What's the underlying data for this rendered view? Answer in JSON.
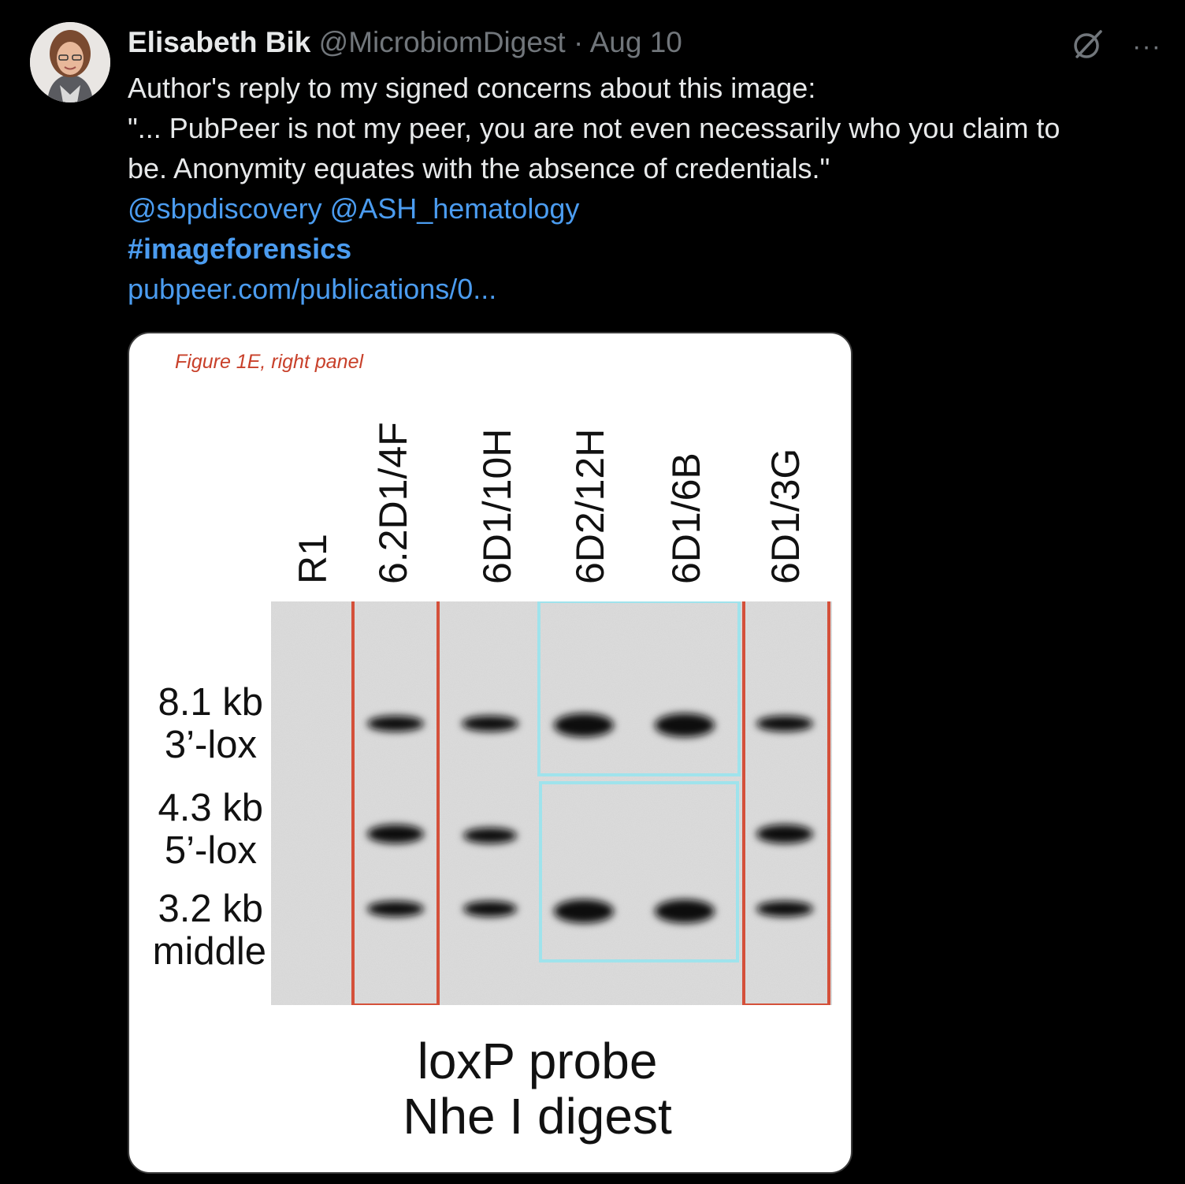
{
  "author": {
    "name": "Elisabeth Bik",
    "handle": "@MicrobiomDigest",
    "separator": "·",
    "date": "Aug 10"
  },
  "icons": {
    "grok": "grok-icon",
    "more": "more-icon",
    "more_glyph": "···"
  },
  "tweet": {
    "line1": "Author's reply to my signed concerns about this image:",
    "line2": "\"... PubPeer is not my peer, you are not even necessarily who you claim to",
    "line3": "be. Anonymity equates with the absence of credentials.\"",
    "mention1": "@sbpdiscovery",
    "mention2": "@ASH_hematology",
    "hashtag": "#imageforensics",
    "link": "pubpeer.com/publications/0..."
  },
  "figure": {
    "caption": "Figure 1E, right panel",
    "lanes": [
      "R1",
      "6.2D1/4F",
      "6D1/10H",
      "6D2/12H",
      "6D1/6B",
      "6D1/3G"
    ],
    "bands": [
      {
        "size": "8.1 kb",
        "name": "3’-lox"
      },
      {
        "size": "4.3 kb",
        "name": "5’-lox"
      },
      {
        "size": "3.2 kb",
        "name": "middle"
      }
    ],
    "probe": "loxP probe",
    "digest": "Nhe I digest",
    "colors": {
      "red_box": "#d4503a",
      "cyan_box": "#9fe3ec"
    }
  }
}
